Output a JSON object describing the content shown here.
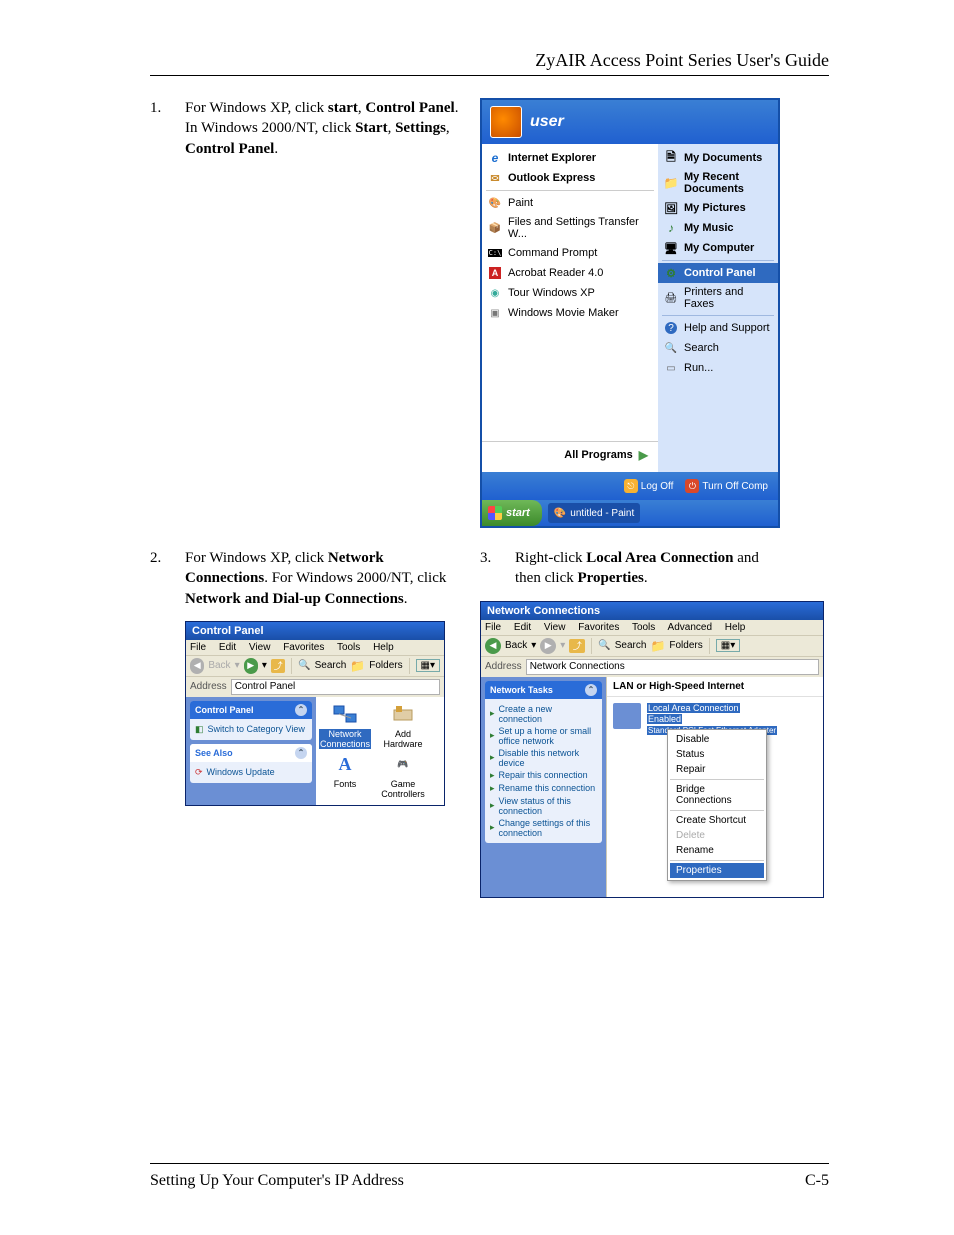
{
  "header": {
    "title": "ZyAIR Access Point Series User's Guide"
  },
  "step1": {
    "num": "1.",
    "parts": [
      "For Windows XP, click ",
      "start",
      ", ",
      "Control Panel",
      ". In Windows 2000/NT, click ",
      "Start",
      ", ",
      "Settings",
      ", ",
      "Control Panel",
      "."
    ]
  },
  "step2": {
    "num": "2.",
    "parts": [
      "For Windows XP, click ",
      "Network Connections",
      ". For Windows 2000/NT, click ",
      "Network and Dial-up Connections",
      "."
    ]
  },
  "step3": {
    "num": "3.",
    "parts": [
      "Right-click ",
      "Local Area Connection",
      " and then click ",
      "Properties",
      "."
    ]
  },
  "startmenu": {
    "user": "user",
    "left_top": [
      {
        "icon": "ie",
        "label": "Internet Explorer"
      },
      {
        "icon": "oe",
        "label": "Outlook Express"
      }
    ],
    "left_bottom": [
      {
        "icon": "paint",
        "label": "Paint"
      },
      {
        "icon": "files",
        "label": "Files and Settings Transfer W..."
      },
      {
        "icon": "cmd",
        "label": "Command Prompt"
      },
      {
        "icon": "acro",
        "label": "Acrobat Reader 4.0"
      },
      {
        "icon": "tour",
        "label": "Tour Windows XP"
      },
      {
        "icon": "movie",
        "label": "Windows Movie Maker"
      }
    ],
    "all_programs": "All Programs",
    "right_top": [
      {
        "icon": "doc",
        "label": "My Documents"
      },
      {
        "icon": "folder",
        "label": "My Recent Documents"
      },
      {
        "icon": "pic",
        "label": "My Pictures"
      },
      {
        "icon": "music",
        "label": "My Music"
      },
      {
        "icon": "comp",
        "label": "My Computer"
      }
    ],
    "right_mid": [
      {
        "icon": "panel",
        "label": "Control Panel",
        "highlight": true
      },
      {
        "icon": "printer",
        "label": "Printers and Faxes"
      }
    ],
    "right_bot": [
      {
        "icon": "help",
        "label": "Help and Support"
      },
      {
        "icon": "search",
        "label": "Search"
      },
      {
        "icon": "run",
        "label": "Run..."
      }
    ],
    "logoff": "Log Off",
    "turnoff": "Turn Off Comp",
    "start_label": "start",
    "taskbar_item": "untitled - Paint"
  },
  "cp": {
    "title": "Control Panel",
    "menus": [
      "File",
      "Edit",
      "View",
      "Favorites",
      "Tools",
      "Help"
    ],
    "toolbar": {
      "back": "Back",
      "search": "Search",
      "folders": "Folders"
    },
    "address_label": "Address",
    "address_value": "Control Panel",
    "side_main_title": "Control Panel",
    "side_main_link": "Switch to Category View",
    "side_seealso_title": "See Also",
    "side_seealso_link": "Windows Update",
    "icons": [
      {
        "label": "Network Connections",
        "sel": true
      },
      {
        "label": "Add Hardware"
      },
      {
        "label": "Fonts"
      },
      {
        "label": "Game Controllers"
      }
    ]
  },
  "nc": {
    "title": "Network Connections",
    "menus": [
      "File",
      "Edit",
      "View",
      "Favorites",
      "Tools",
      "Advanced",
      "Help"
    ],
    "toolbar": {
      "back": "Back",
      "search": "Search",
      "folders": "Folders"
    },
    "address_label": "Address",
    "address_value": "Network Connections",
    "side_title": "Network Tasks",
    "side_links": [
      "Create a new connection",
      "Set up a home or small office network",
      "Disable this network device",
      "Repair this connection",
      "Rename this connection",
      "View status of this connection",
      "Change settings of this connection"
    ],
    "group": "LAN or High-Speed Internet",
    "conn_name": "Local Area Connection",
    "conn_status": "Enabled",
    "conn_adapter": "Standard PCI Fast Ethernet Adapter",
    "ctx": [
      "Disable",
      "Status",
      "Repair",
      "__hr__",
      "Bridge Connections",
      "__hr__",
      "Create Shortcut",
      "Delete",
      "Rename",
      "__hr__",
      "Properties"
    ],
    "ctx_disabled": [
      "Delete"
    ],
    "ctx_selected": "Properties"
  },
  "footer": {
    "left": "Setting Up Your Computer's IP Address",
    "right": "C-5"
  }
}
